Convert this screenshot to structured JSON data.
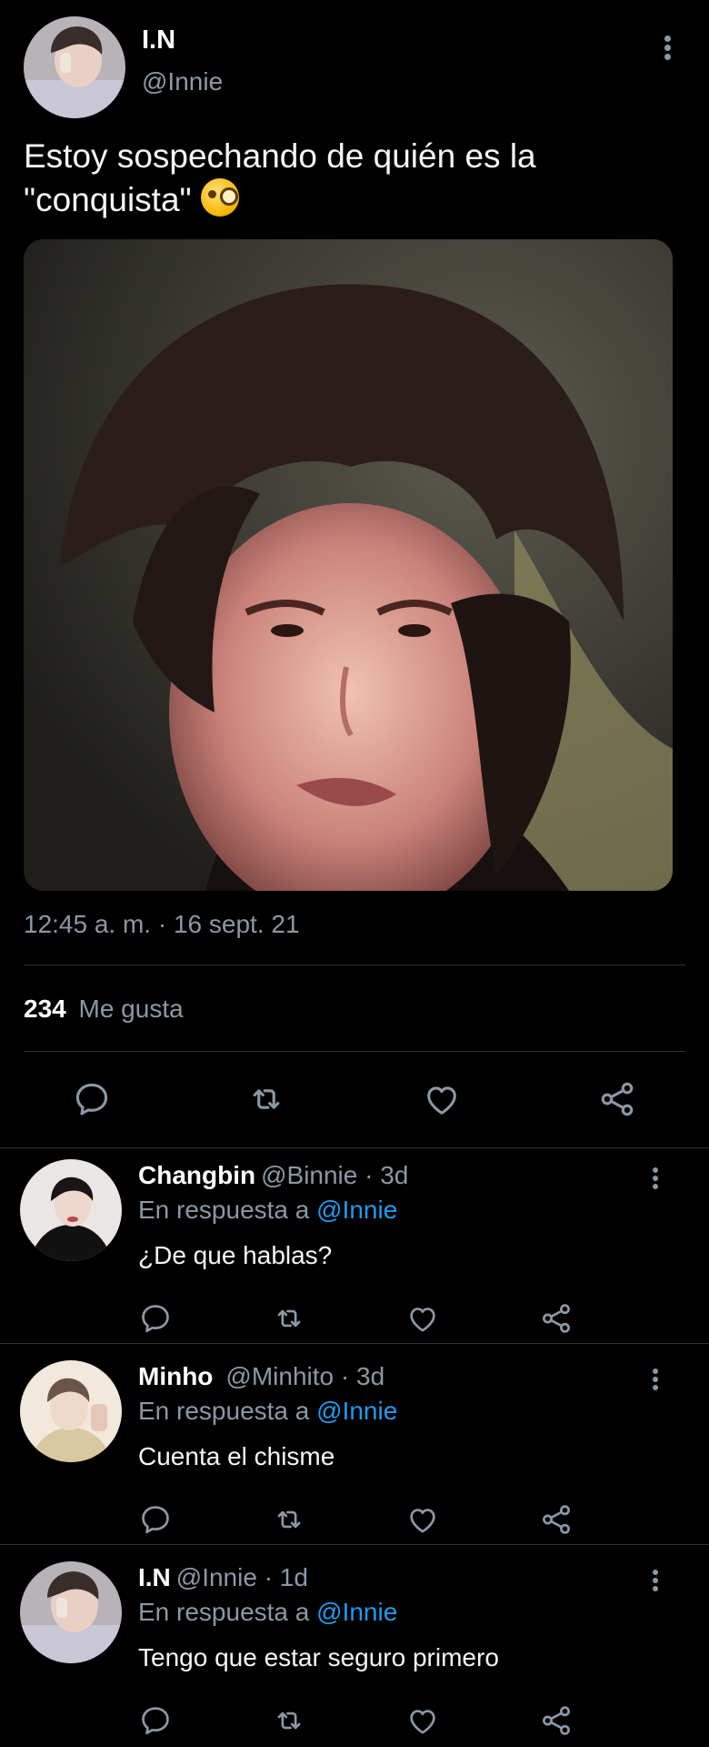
{
  "tweet": {
    "name": "I.N",
    "handle": "@Innie",
    "text": "Estoy sospechando de quién es la \"conquista\"",
    "emoji": "face-with-monocle",
    "timestamp": "12:45 a. m. · 16 sept. 21",
    "likes_count": "234",
    "likes_label": "Me gusta"
  },
  "replies": [
    {
      "name": "Changbin",
      "meta": "@Binnie · 3d",
      "reply_prefix": "En respuesta a ",
      "reply_mention": "@Innie",
      "text": "¿De que hablas?"
    },
    {
      "name": "Minho",
      "meta": "@Minhito · 3d",
      "reply_prefix": "En respuesta a ",
      "reply_mention": "@Innie",
      "text": "Cuenta el chisme"
    },
    {
      "name": "I.N",
      "meta": "@Innie · 1d",
      "reply_prefix": "En respuesta a ",
      "reply_mention": "@Innie",
      "text": "Tengo que estar seguro primero"
    }
  ],
  "icons": [
    "reply-icon",
    "retweet-icon",
    "like-icon",
    "share-icon",
    "more-icon"
  ],
  "colors": {
    "background": "#000000",
    "text_primary": "#e7e9ea",
    "text_secondary": "#8b98a5",
    "mention": "#1d9bf0",
    "divider": "#2f3336"
  }
}
